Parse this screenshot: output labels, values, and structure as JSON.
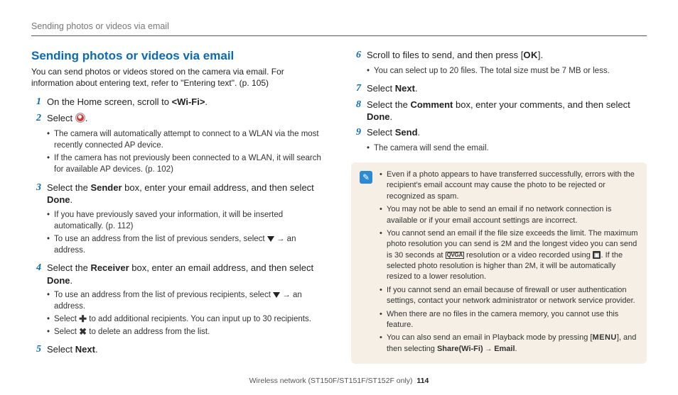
{
  "header": {
    "running": "Sending photos or videos via email"
  },
  "left": {
    "title": "Sending photos or videos via email",
    "intro": "You can send photos or videos stored on the camera via email. For information about entering text, refer to \"Entering text\". (p. 105)",
    "step1": {
      "num": "1",
      "pre": "On the Home screen, scroll to ",
      "bold": "<Wi-Fi>",
      "post": "."
    },
    "step2": {
      "num": "2",
      "pre": "Select ",
      "post": "."
    },
    "step2_subs": [
      "The camera will automatically attempt to connect to a WLAN via the most recently connected AP device.",
      "If the camera has not previously been connected to a WLAN, it will search for available AP devices. (p. 102)"
    ],
    "step3": {
      "num": "3",
      "a": "Select the ",
      "b": "Sender",
      "c": " box, enter your email address, and then select ",
      "d": "Done",
      "e": "."
    },
    "step3_subs": {
      "a": "If you have previously saved your information, it will be inserted automatically. (p. 112)",
      "b_pre": "To use an address from the list of previous senders, select ",
      "b_post": " → an address."
    },
    "step4": {
      "num": "4",
      "a": "Select the ",
      "b": "Receiver",
      "c": " box, enter an email address, and then select ",
      "d": "Done",
      "e": "."
    },
    "step4_subs": {
      "a_pre": "To use an address from the list of previous recipients, select ",
      "a_post": " → an address.",
      "b_pre": "Select ",
      "b_post": " to add additional recipients. You can input up to 30 recipients.",
      "c_pre": "Select ",
      "c_post": " to delete an address from the list."
    },
    "step5": {
      "num": "5",
      "a": "Select ",
      "b": "Next",
      "c": "."
    }
  },
  "right": {
    "step6": {
      "num": "6",
      "a": "Scroll to files to send, and then press [",
      "b": "OK",
      "c": "]."
    },
    "step6_sub": "You can select up to 20 files. The total size must be 7 MB or less.",
    "step7": {
      "num": "7",
      "a": "Select ",
      "b": "Next",
      "c": "."
    },
    "step8": {
      "num": "8",
      "a": "Select the ",
      "b": "Comment",
      "c": " box, enter your comments, and then select ",
      "d": "Done",
      "e": "."
    },
    "step9": {
      "num": "9",
      "a": "Select ",
      "b": "Send",
      "c": "."
    },
    "step9_sub": "The camera will send the email.",
    "notes": {
      "n1": "Even if a photo appears to have transferred successfully, errors with the recipient's email account may cause the photo to be rejected or recognized as spam.",
      "n2": "You may not be able to send an email if no network connection is available or if your email account settings are incorrect.",
      "n3_a": "You cannot send an email if the file size exceeds the limit. The maximum photo resolution you can send is 2M and the longest video you can send is 30 seconds at ",
      "n3_qvga": "QVGA",
      "n3_b": " resolution or a video recorded using ",
      "n3_rec": "▣",
      "n3_c": ". If the selected photo resolution is higher than 2M, it will be automatically resized to a lower resolution.",
      "n4": "If you cannot send an email because of firewall or user authentication settings, contact your network administrator or network service provider.",
      "n5": "When there are no files in the camera memory, you cannot use this feature.",
      "n6_a": "You can also send an email in Playback mode by pressing [",
      "n6_menu": "MENU",
      "n6_b": "], and then selecting ",
      "n6_share": "Share(Wi-Fi)",
      "n6_arrow": " → ",
      "n6_email": "Email",
      "n6_c": "."
    }
  },
  "footer": {
    "text": "Wireless network  (ST150F/ST151F/ST152F only)",
    "page": "114"
  }
}
